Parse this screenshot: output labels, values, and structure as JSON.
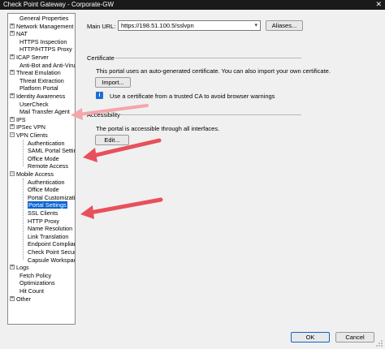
{
  "window": {
    "title": "Check Point Gateway - Corporate-GW",
    "close_glyph": "✕"
  },
  "tree": [
    {
      "label": "General Properties",
      "level": 0,
      "exp": ""
    },
    {
      "label": "Network Management",
      "level": 0,
      "exp": "+"
    },
    {
      "label": "NAT",
      "level": 0,
      "exp": "+"
    },
    {
      "label": "HTTPS Inspection",
      "level": 0,
      "exp": ""
    },
    {
      "label": "HTTP/HTTPS Proxy",
      "level": 0,
      "exp": ""
    },
    {
      "label": "ICAP Server",
      "level": 0,
      "exp": "+"
    },
    {
      "label": "Anti-Bot and Anti-Virus",
      "level": 0,
      "exp": ""
    },
    {
      "label": "Threat Emulation",
      "level": 0,
      "exp": "+"
    },
    {
      "label": "Threat Extraction",
      "level": 0,
      "exp": ""
    },
    {
      "label": "Platform Portal",
      "level": 0,
      "exp": ""
    },
    {
      "label": "Identity Awareness",
      "level": 0,
      "exp": "+"
    },
    {
      "label": "UserCheck",
      "level": 0,
      "exp": ""
    },
    {
      "label": "Mail Transfer Agent",
      "level": 0,
      "exp": ""
    },
    {
      "label": "IPS",
      "level": 0,
      "exp": "+"
    },
    {
      "label": "IPSec VPN",
      "level": 0,
      "exp": "+"
    },
    {
      "label": "VPN Clients",
      "level": 0,
      "exp": "−"
    },
    {
      "label": "Authentication",
      "level": 1,
      "exp": ""
    },
    {
      "label": "SAML Portal Settin",
      "level": 1,
      "exp": ""
    },
    {
      "label": "Office Mode",
      "level": 1,
      "exp": ""
    },
    {
      "label": "Remote Access",
      "level": 1,
      "exp": ""
    },
    {
      "label": "Mobile Access",
      "level": 0,
      "exp": "−"
    },
    {
      "label": "Authentication",
      "level": 1,
      "exp": ""
    },
    {
      "label": "Office Mode",
      "level": 1,
      "exp": ""
    },
    {
      "label": "Portal Customizatio",
      "level": 1,
      "exp": ""
    },
    {
      "label": "Portal Settings",
      "level": 1,
      "exp": "",
      "selected": true
    },
    {
      "label": "SSL Clients",
      "level": 1,
      "exp": ""
    },
    {
      "label": "HTTP Proxy",
      "level": 1,
      "exp": ""
    },
    {
      "label": "Name Resolution",
      "level": 1,
      "exp": ""
    },
    {
      "label": "Link Translation",
      "level": 1,
      "exp": ""
    },
    {
      "label": "Endpoint Complian",
      "level": 1,
      "exp": ""
    },
    {
      "label": "Check Point Secur",
      "level": 1,
      "exp": ""
    },
    {
      "label": "Capsule Workspac",
      "level": 1,
      "exp": ""
    },
    {
      "label": "Logs",
      "level": 0,
      "exp": "+"
    },
    {
      "label": "Fetch Policy",
      "level": 0,
      "exp": ""
    },
    {
      "label": "Optimizations",
      "level": 0,
      "exp": ""
    },
    {
      "label": "Hit Count",
      "level": 0,
      "exp": ""
    },
    {
      "label": "Other",
      "level": 0,
      "exp": "+"
    }
  ],
  "main": {
    "main_url_label": "Main URL:",
    "main_url_value": "https://198.51.100.5/sslvpn",
    "aliases_label": "Aliases...",
    "certificate": {
      "heading": "Certificate",
      "description": "This portal uses an auto-generated certificate. You can also import your own certificate.",
      "import_label": "Import...",
      "info_text": "Use a certificate from a trusted CA to avoid browser warnings",
      "info_icon": "i"
    },
    "accessibility": {
      "heading": "Accessibility",
      "description": "The portal is accessible through all interfaces.",
      "edit_label": "Edit..."
    }
  },
  "footer": {
    "ok_label": "OK",
    "cancel_label": "Cancel"
  },
  "colors": {
    "arrow": "#e8505b",
    "selection": "#0a64d0",
    "titlebar": "#1a1a1a"
  }
}
